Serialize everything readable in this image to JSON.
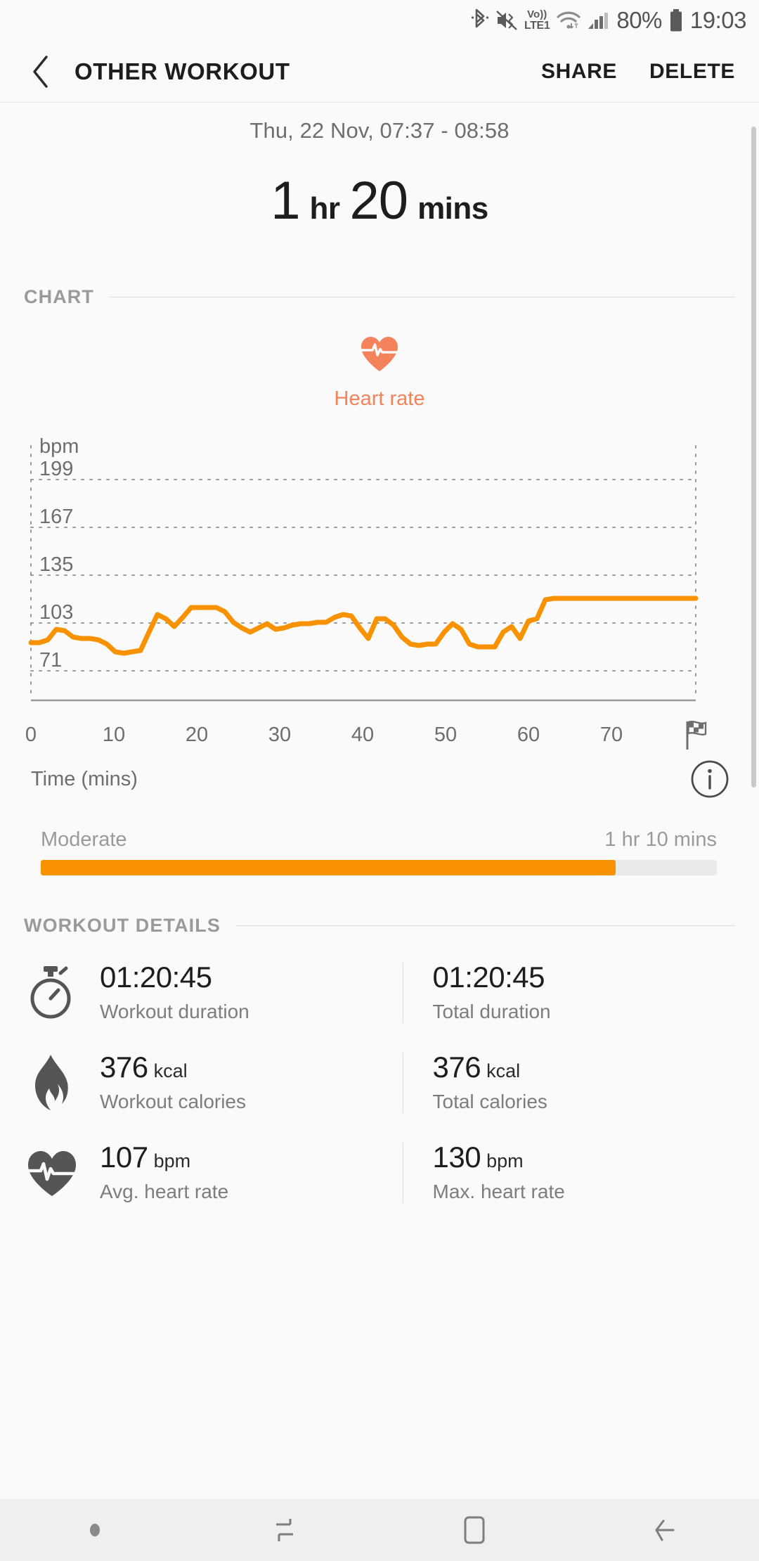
{
  "status_bar": {
    "icons": [
      "bluetooth-icon",
      "mute-icon",
      "volte-icon",
      "wifi-icon",
      "signal-icon",
      "battery-icon"
    ],
    "volte_line1": "Vo))",
    "volte_line2": "LTE1",
    "battery_percent": "80%",
    "time": "19:03"
  },
  "app_bar": {
    "back_icon": "chevron-left-icon",
    "title": "OTHER WORKOUT",
    "share_label": "SHARE",
    "delete_label": "DELETE"
  },
  "summary": {
    "date_range": "Thu, 22 Nov, 07:37 - 08:58",
    "duration_hours": "1",
    "duration_hours_unit": "hr",
    "duration_minutes": "20",
    "duration_minutes_unit": "mins"
  },
  "chart_section": {
    "header": "CHART",
    "metric_icon": "heart-rate-icon",
    "metric_label": "Heart rate",
    "metric_color": "#f4825b",
    "info_icon": "info-icon",
    "finish_icon": "checkered-flag-icon",
    "axis_title": "Time (mins)"
  },
  "zone": {
    "name": "Moderate",
    "time": "1 hr 10 mins",
    "fill_percent": 85,
    "color": "#f99200"
  },
  "details_section": {
    "header": "WORKOUT DETAILS",
    "rows": [
      {
        "icon": "stopwatch-icon",
        "left": {
          "value": "01:20:45",
          "unit": "",
          "label": "Workout duration"
        },
        "right": {
          "value": "01:20:45",
          "unit": "",
          "label": "Total duration"
        }
      },
      {
        "icon": "flame-icon",
        "left": {
          "value": "376",
          "unit": "kcal",
          "label": "Workout calories"
        },
        "right": {
          "value": "376",
          "unit": "kcal",
          "label": "Total calories"
        }
      },
      {
        "icon": "heart-pulse-icon",
        "left": {
          "value": "107",
          "unit": "bpm",
          "label": "Avg. heart rate"
        },
        "right": {
          "value": "130",
          "unit": "bpm",
          "label": "Max. heart rate"
        }
      }
    ]
  },
  "nav_bar": {
    "items": [
      "dot-indicator",
      "recents-icon",
      "home-icon",
      "back-icon"
    ]
  },
  "chart_data": {
    "type": "line",
    "title": "Heart rate",
    "xlabel": "Time (mins)",
    "ylabel": "bpm",
    "ylabel_text": "bpm",
    "grid": true,
    "legend": "Heart rate",
    "line_color": "#f99200",
    "xlim": [
      0,
      80
    ],
    "ylim": [
      39,
      231
    ],
    "yticks": [
      199,
      167,
      135,
      103,
      71
    ],
    "xticks": [
      0,
      10,
      20,
      30,
      40,
      50,
      60,
      70
    ],
    "x": [
      0,
      1,
      2,
      3,
      4,
      5,
      6,
      7,
      8,
      9,
      10,
      11,
      12,
      13,
      14,
      15,
      16,
      17,
      18,
      19,
      20,
      21,
      22,
      23,
      24,
      25,
      26,
      27,
      28,
      29,
      30,
      31,
      32,
      33,
      34,
      35,
      36,
      37,
      38,
      39,
      40,
      41,
      42,
      43,
      44,
      45,
      46,
      47,
      48,
      49,
      50,
      51,
      52,
      53,
      54,
      55,
      56,
      57,
      58,
      59,
      60,
      61,
      62,
      63,
      64,
      65,
      66,
      67,
      68,
      69,
      70,
      71,
      72,
      73,
      74,
      75,
      76,
      77,
      78,
      79,
      80
    ],
    "y": [
      89,
      89,
      91,
      98,
      97,
      93,
      92,
      92,
      91,
      88,
      83,
      82,
      83,
      84,
      96,
      108,
      105,
      100,
      106,
      113,
      113,
      113,
      113,
      110,
      103,
      99,
      96,
      99,
      102,
      98,
      99,
      101,
      102,
      102,
      103,
      103,
      106,
      108,
      107,
      99,
      92,
      105,
      105,
      101,
      93,
      88,
      87,
      88,
      88,
      96,
      102,
      98,
      88,
      86,
      86,
      86,
      96,
      100,
      92,
      104,
      105,
      118,
      119,
      119,
      119,
      119,
      119,
      119,
      119,
      119,
      119,
      119,
      119,
      119,
      119,
      119,
      119,
      119,
      119,
      119,
      119
    ]
  }
}
